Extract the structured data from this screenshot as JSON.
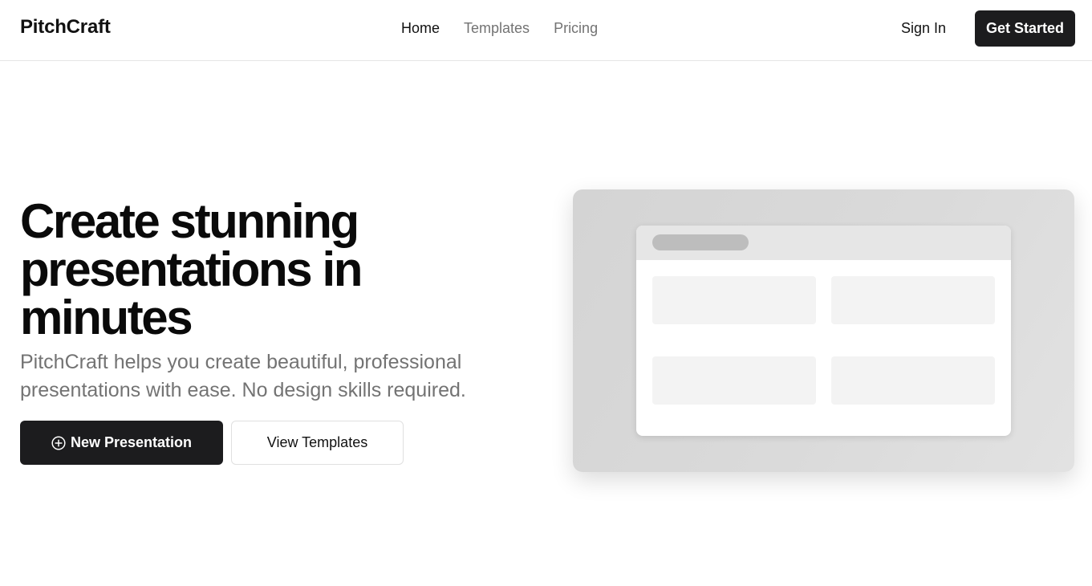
{
  "header": {
    "brand": "PitchCraft",
    "nav": [
      {
        "label": "Home",
        "active": true
      },
      {
        "label": "Templates",
        "active": false
      },
      {
        "label": "Pricing",
        "active": false
      }
    ],
    "sign_in": "Sign In",
    "get_started": "Get Started"
  },
  "hero": {
    "title": "Create stunning presentations in minutes",
    "subtitle": "PitchCraft helps you create beautiful, professional presentations with ease. No design skills required.",
    "primary_button": "New Presentation",
    "primary_icon": "plus-circle-icon",
    "secondary_button": "View Templates"
  },
  "colors": {
    "primary": "#1c1c1e",
    "muted_text": "#737373",
    "border": "#e5e5e5"
  }
}
